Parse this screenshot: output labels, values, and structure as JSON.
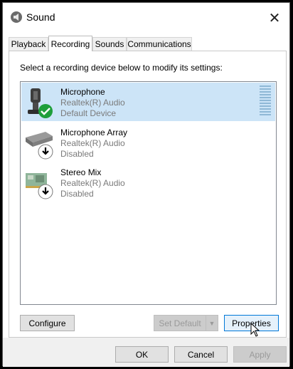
{
  "window": {
    "title": "Sound",
    "close_icon": "close-icon"
  },
  "tabs": [
    {
      "label": "Playback",
      "active": false
    },
    {
      "label": "Recording",
      "active": true
    },
    {
      "label": "Sounds",
      "active": false
    },
    {
      "label": "Communications",
      "active": false
    }
  ],
  "instruction": "Select a recording device below to modify its settings:",
  "devices": [
    {
      "name": "Microphone",
      "driver": "Realtek(R) Audio",
      "status": "Default Device",
      "icon": "microphone-icon",
      "badge": "default-check-icon",
      "selected": true
    },
    {
      "name": "Microphone Array",
      "driver": "Realtek(R) Audio",
      "status": "Disabled",
      "icon": "microphone-array-icon",
      "badge": "disabled-arrow-icon",
      "selected": false
    },
    {
      "name": "Stereo Mix",
      "driver": "Realtek(R) Audio",
      "status": "Disabled",
      "icon": "sound-card-icon",
      "badge": "disabled-arrow-icon",
      "selected": false
    }
  ],
  "buttons": {
    "configure": "Configure",
    "set_default": "Set Default",
    "properties": "Properties",
    "ok": "OK",
    "cancel": "Cancel",
    "apply": "Apply"
  },
  "colors": {
    "selection": "#cce4f7",
    "check_badge": "#1e9e3a",
    "meter": "#8fb8d6"
  }
}
